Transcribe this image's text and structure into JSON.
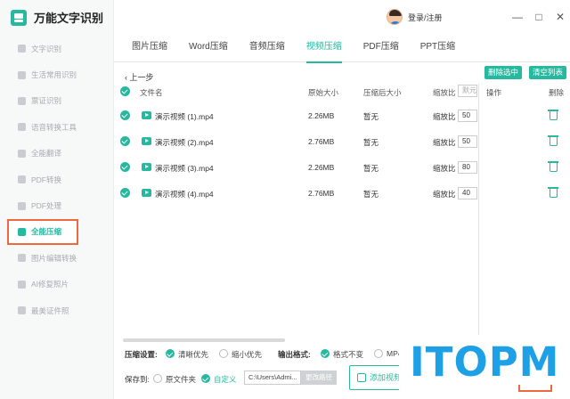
{
  "app": {
    "title": "万能文字识别"
  },
  "header": {
    "login_label": "登录/注册",
    "min_glyph": "—",
    "max_glyph": "□",
    "close_glyph": "✕"
  },
  "sidebar": {
    "items": [
      {
        "label": "文字识别",
        "active": false
      },
      {
        "label": "生活常用识别",
        "active": false
      },
      {
        "label": "票证识别",
        "active": false
      },
      {
        "label": "语音转换工具",
        "active": false
      },
      {
        "label": "全能翻译",
        "active": false
      },
      {
        "label": "PDF转换",
        "active": false
      },
      {
        "label": "PDF处理",
        "active": false
      },
      {
        "label": "全能压缩",
        "active": true
      },
      {
        "label": "图片编辑转换",
        "active": false
      },
      {
        "label": "AI修复照片",
        "active": false
      },
      {
        "label": "最美证件照",
        "active": false
      }
    ]
  },
  "tabs": [
    {
      "label": "图片压缩"
    },
    {
      "label": "Word压缩"
    },
    {
      "label": "音频压缩"
    },
    {
      "label": "视频压缩",
      "active": true
    },
    {
      "label": "PDF压缩"
    },
    {
      "label": "PPT压缩"
    }
  ],
  "toolbar": {
    "back_label": "上一步",
    "delete_selected": "删除选中",
    "clear_list": "清空列表"
  },
  "table": {
    "headers": {
      "name": "文件名",
      "original": "原始大小",
      "compressed": "压缩后大小",
      "ratio": "缩放比",
      "ratio_placeholder": "默元",
      "ops": "操作",
      "delete": "删除"
    },
    "rows": [
      {
        "name": "演示视频 (1).mp4",
        "original": "2.26MB",
        "compressed": "暂无",
        "ratio_label": "缩放比",
        "ratio": "50"
      },
      {
        "name": "演示视频 (2).mp4",
        "original": "2.76MB",
        "compressed": "暂无",
        "ratio_label": "缩放比",
        "ratio": "50"
      },
      {
        "name": "演示视频 (3).mp4",
        "original": "2.26MB",
        "compressed": "暂无",
        "ratio_label": "缩放比",
        "ratio": "80"
      },
      {
        "name": "演示视频 (4).mp4",
        "original": "2.76MB",
        "compressed": "暂无",
        "ratio_label": "缩放比",
        "ratio": "40"
      }
    ]
  },
  "settings": {
    "compress_label": "压缩设置:",
    "compress_opt1": "清晰优先",
    "compress_opt2": "缩小优先",
    "output_label": "输出格式:",
    "output_opt1": "格式不变",
    "output_opt2": "MP4",
    "save_label": "保存到:",
    "save_opt1": "原文件夹",
    "save_opt2": "自定义",
    "path_value": "C:\\Users\\Admi...",
    "path_button": "更改路径",
    "add_button": "添加视频"
  },
  "watermark": {
    "text": "ITOPM"
  },
  "colors": {
    "accent": "#26b9a0",
    "highlight": "#ee6a3e",
    "watermark": "#1ea0e6"
  }
}
